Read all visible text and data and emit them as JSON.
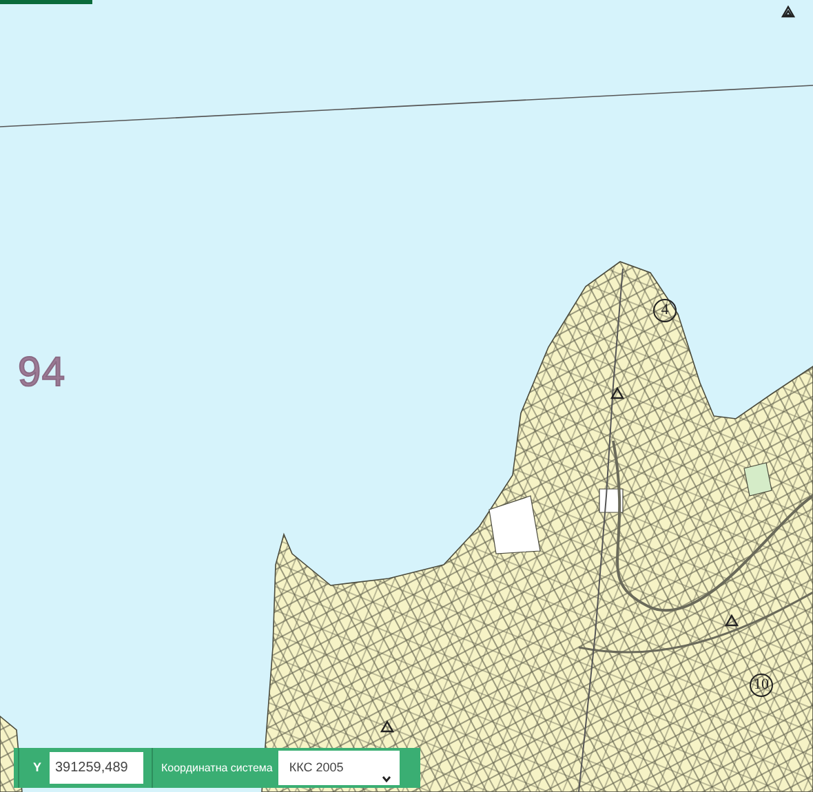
{
  "map": {
    "labels": [
      {
        "kind": "sheet_number",
        "text": "94"
      },
      {
        "kind": "circled",
        "text": "4"
      },
      {
        "kind": "circled",
        "text": "10"
      }
    ]
  },
  "coordinates_bar": {
    "axis_label": "Y",
    "value": "391259,489",
    "system_label": "Координатна система",
    "system_value": "ККС 2005"
  }
}
